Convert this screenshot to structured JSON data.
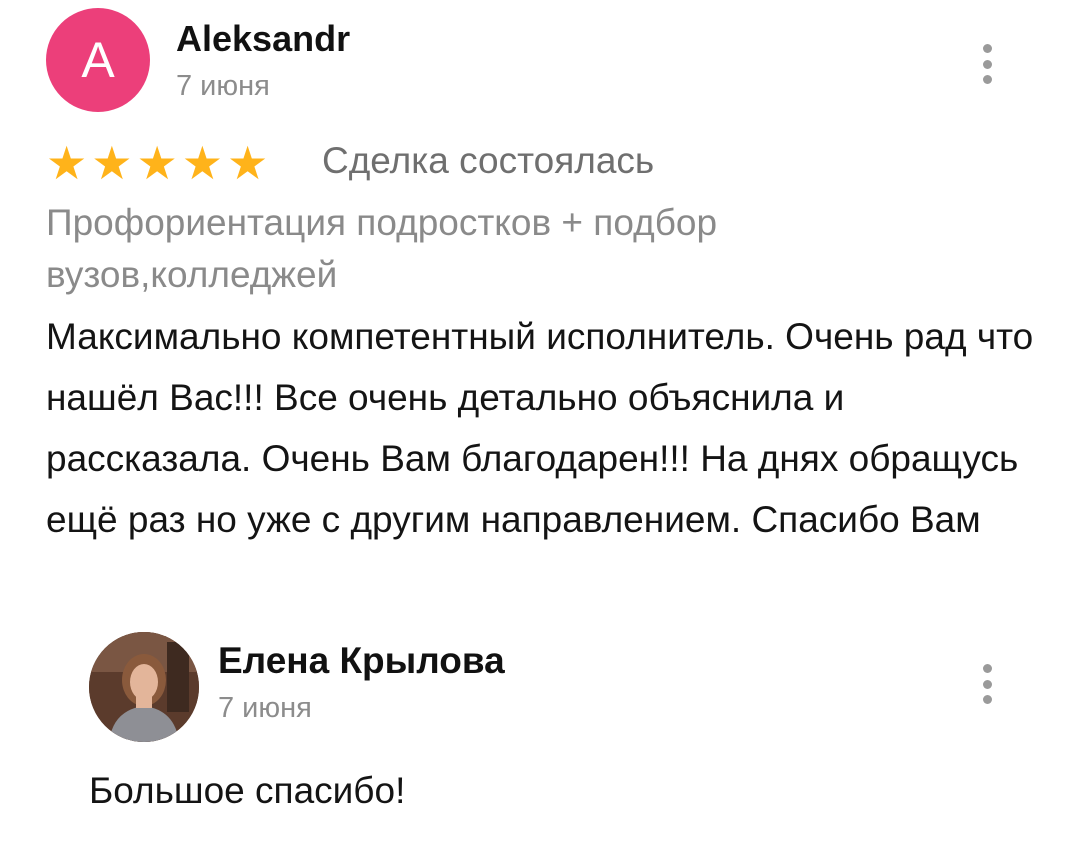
{
  "review": {
    "avatar_letter": "A",
    "author": "Aleksandr",
    "date": "7 июня",
    "rating": 5,
    "star_glyph": "★",
    "deal_status": "Сделка состоялась",
    "service": "Профориентация подростков + подбор вузов,колледжей",
    "text": "Максимально компетентный исполнитель. Очень рад что нашёл Вас!!! Все очень детально объяснила и рассказала. Очень Вам благодарен!!! На днях обращусь ещё раз но уже с другим направлением. Спасибо Вам",
    "more_icon": "more-vertical-icon"
  },
  "reply": {
    "author": "Елена Крылова",
    "date": "7 июня",
    "text": "Большое спасибо!",
    "more_icon": "more-vertical-icon"
  },
  "colors": {
    "avatar_bg": "#ec3f7a",
    "star": "#ffb31a",
    "secondary_text": "#8a8a8a",
    "primary_text": "#141414"
  }
}
